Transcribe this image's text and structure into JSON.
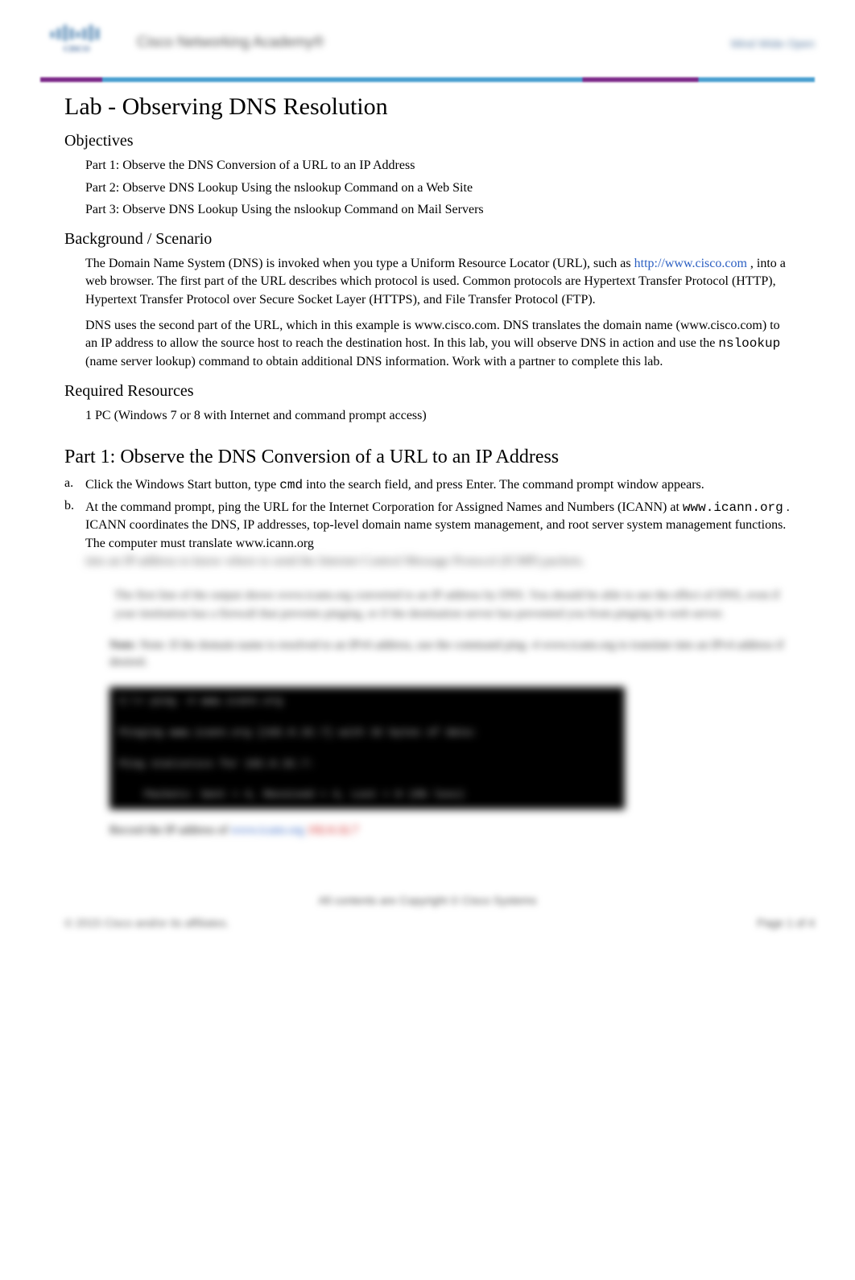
{
  "header": {
    "logo_text": "CISCO",
    "center_text": "Cisco Networking Academy®",
    "right_text": "Mind Wide Open"
  },
  "title": "Lab - Observing DNS Resolution",
  "objectives": {
    "heading": "Objectives",
    "items": [
      "Part 1: Observe the DNS Conversion of a URL to an IP Address",
      "Part 2: Observe DNS Lookup Using the nslookup Command on a Web Site",
      "Part 3: Observe DNS Lookup Using the nslookup Command on Mail Servers"
    ]
  },
  "background": {
    "heading": "Background / Scenario",
    "para1_pre": "The Domain Name System (DNS) is invoked when you type a Uniform Resource Locator (URL), such as ",
    "para1_link": "http://www.cisco.com",
    "para1_post": " , into a web browser. The first part of the URL describes which protocol is used. Common protocols are Hypertext Transfer Protocol (HTTP), Hypertext Transfer Protocol over Secure Socket Layer (HTTPS), and File Transfer Protocol (FTP).",
    "para2_pre": "DNS uses the second part of the URL, which in this example is www.cisco.com. DNS translates the domain name (www.cisco.com) to an IP address to allow the source host to reach the destination host. In this lab, you will observe DNS in action and use the ",
    "para2_cmd": "nslookup",
    "para2_post": " (name server lookup) command to obtain additional DNS information. Work with a partner to complete this lab."
  },
  "resources": {
    "heading": "Required Resources",
    "item": "1 PC (Windows 7 or 8 with Internet and command prompt access)"
  },
  "part1": {
    "heading": "Part 1: Observe the DNS Conversion of a URL to an IP Address",
    "step_a": {
      "letter": "a.",
      "pre": "Click the ",
      "btn": "Windows Start",
      "mid1": " button, type ",
      "cmd": "cmd",
      "mid2": " into the search field,",
      "post": " and press Enter. The command prompt window appears."
    },
    "step_b": {
      "letter": "b.",
      "pre": "At the command prompt, ping the URL for the Internet Corporation for Assigned Names and Numbers (ICANN) at ",
      "cmd": "www.icann.org",
      "post": " . ICANN coordinates the DNS, IP addresses, top-level domain name system management, and root server system management functions. The computer must translate www.icann.org",
      "blurred_tail": "into an IP address to know where to send the Internet Control Message Protocol (ICMP) packets."
    },
    "blur_block_1": "The first line of the output shows www.icann.org converted to an IP address by DNS. You should be able to see the effect of DNS, even if your institution has a firewall that prevents pinging, or if the destination server has prevented you from pinging its web server.",
    "note_block": "Note: If the domain name is resolved to an IPv6 address, use the command ping -4 www.icann.org to translate into an IPv4 address if desired.",
    "terminal_lines": [
      "C:\\> ping -4 www.icann.org",
      "Pinging www.icann.org [192.0.32.7] with 32 bytes of data:",
      "Ping statistics for 192.0.32.7:",
      "    Packets: Sent = 4, Received = 4, Lost = 0 (0% loss)"
    ],
    "answer_pre": "Record the IP address of ",
    "answer_link": "www.icann.org",
    "answer_sep": " ",
    "answer_red": "192.0.32.7"
  },
  "footer": {
    "center": "All contents are Copyright © Cisco Systems",
    "left": "© 2015 Cisco and/or its affiliates.",
    "right": "Page 1 of 4"
  }
}
